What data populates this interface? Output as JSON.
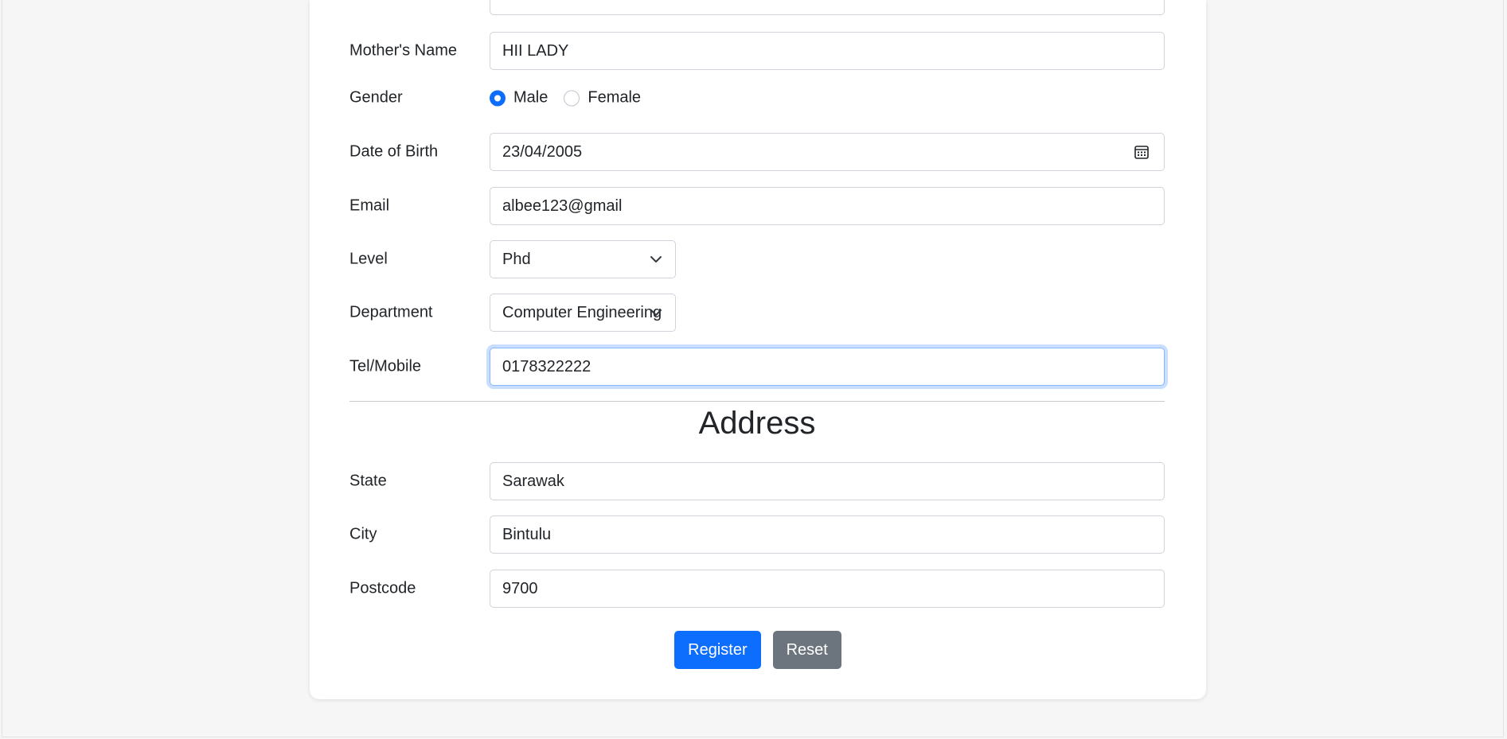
{
  "form": {
    "mother_name": {
      "label": "Mother's Name",
      "value": "HII LADY"
    },
    "gender": {
      "label": "Gender",
      "options": [
        {
          "label": "Male",
          "checked": true
        },
        {
          "label": "Female",
          "checked": false
        }
      ]
    },
    "dob": {
      "label": "Date of Birth",
      "value": "23/04/2005"
    },
    "email": {
      "label": "Email",
      "value": "albee123@gmail"
    },
    "level": {
      "label": "Level",
      "selected": "Phd"
    },
    "department": {
      "label": "Department",
      "selected": "Computer Engineering"
    },
    "phone": {
      "label": "Tel/Mobile",
      "value": "0178322222"
    }
  },
  "address": {
    "title": "Address",
    "state": {
      "label": "State",
      "value": "Sarawak"
    },
    "city": {
      "label": "City",
      "value": "Bintulu"
    },
    "postcode": {
      "label": "Postcode",
      "value": "9700"
    }
  },
  "actions": {
    "register_label": "Register",
    "reset_label": "Reset"
  },
  "colors": {
    "primary": "#0d6efd",
    "secondary": "#6c757d",
    "focus_ring": "#86b7fe"
  },
  "icons": {
    "calendar": "calendar-icon",
    "select_arrow": "chevron-down-icon"
  }
}
